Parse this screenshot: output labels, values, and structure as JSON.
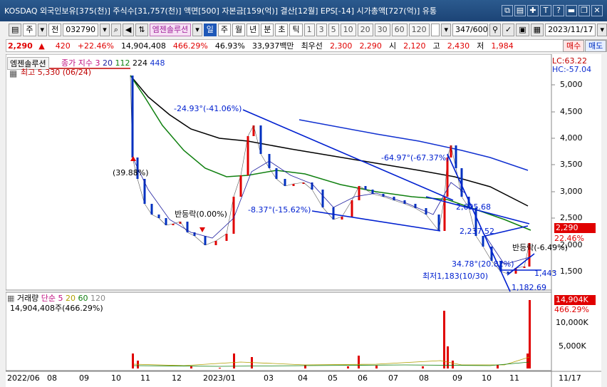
{
  "window": {
    "title": "KOSDAQ 외국인보유[375(천)] 주식수[31,757(천)] 액면[500] 자본금[159(억)] 결산[12월] EPS[-14] 시가총액[727(억)] 유통",
    "buttons": [
      "⧉",
      "▤",
      "✚",
      "T",
      "?",
      "▬",
      "❐",
      "✕"
    ]
  },
  "toolbar": {
    "market": "주",
    "prefix": "전",
    "code": "032790",
    "stock_name": "엠젠솔루션",
    "periods": [
      "일",
      "주",
      "월",
      "년",
      "분",
      "초",
      "틱"
    ],
    "selected_period": "일",
    "intervals": [
      "1",
      "3",
      "5",
      "10",
      "20",
      "30",
      "60",
      "120"
    ],
    "count": "347/600",
    "date": "2023/11/17"
  },
  "info": {
    "price": "2,290",
    "arrow": "▲",
    "change": "420",
    "change_pct": "+22.46%",
    "volume": "14,904,408",
    "vol_pct": "466.29%",
    "turnover_pct": "46.93%",
    "amount": "33,937백만",
    "best_label": "최우선",
    "ask": "2,300",
    "bid": "2,290",
    "open_label": "시",
    "open": "2,120",
    "high_label": "고",
    "high": "2,430",
    "low_label": "저",
    "low": "1,984",
    "buy_label": "매수",
    "sell_label": "매도"
  },
  "price_panel": {
    "stock_label": "엠젠솔루션",
    "legend_close": "종가 지수 3",
    "ma_20": "20",
    "ma_112": "112",
    "ma_224": "224",
    "ma_448": "448",
    "max_label": "최고 5,330 (06/24)",
    "lc": "LC:63.22",
    "hc": "HC:-57.04",
    "current_tag": "2,290",
    "current_pct": "22.46%",
    "y_ticks": [
      "5,000",
      "4,500",
      "4,000",
      "3,500",
      "3,000",
      "2,500",
      "2,000",
      "1,500"
    ],
    "annotations": {
      "a1": "-24.93°(-41.06%)",
      "a2": "(39.88%)",
      "a3": "반등락(0.00%)",
      "a4": "-8.37°(-15.62%)",
      "a5": "-64.97°(-67.37%)",
      "a6": "2,695.68",
      "a7": "2,237.52",
      "a8": "반등락(-6.49%)",
      "a9": "34.78°(20.82%)",
      "a10": "최저1,183(10/30)",
      "a11": "1,443",
      "a12": "1,182.69"
    }
  },
  "volume_panel": {
    "label": "거래량",
    "ma_label": "단순 5",
    "ma_20": "20",
    "ma_60": "60",
    "ma_120": "120",
    "value_text": "14,904,408주(466.29%)",
    "current_tag": "14,904K",
    "current_pct": "466.29%",
    "y_ticks": [
      "10,000K",
      "5,000K"
    ]
  },
  "x_axis": {
    "labels": [
      "2022/06",
      "08",
      "09",
      "10",
      "11",
      "12",
      "2023/01",
      "03",
      "04",
      "05",
      "06",
      "07",
      "08",
      "09",
      "10",
      "11",
      "11/17"
    ]
  },
  "colors": {
    "up": "#e00000",
    "down": "#0030c0",
    "ma20": "#2020a0",
    "ma112": "#108010",
    "ma224": "#000000",
    "ma448": "#1030d0",
    "trendline": "#0020d0"
  }
}
